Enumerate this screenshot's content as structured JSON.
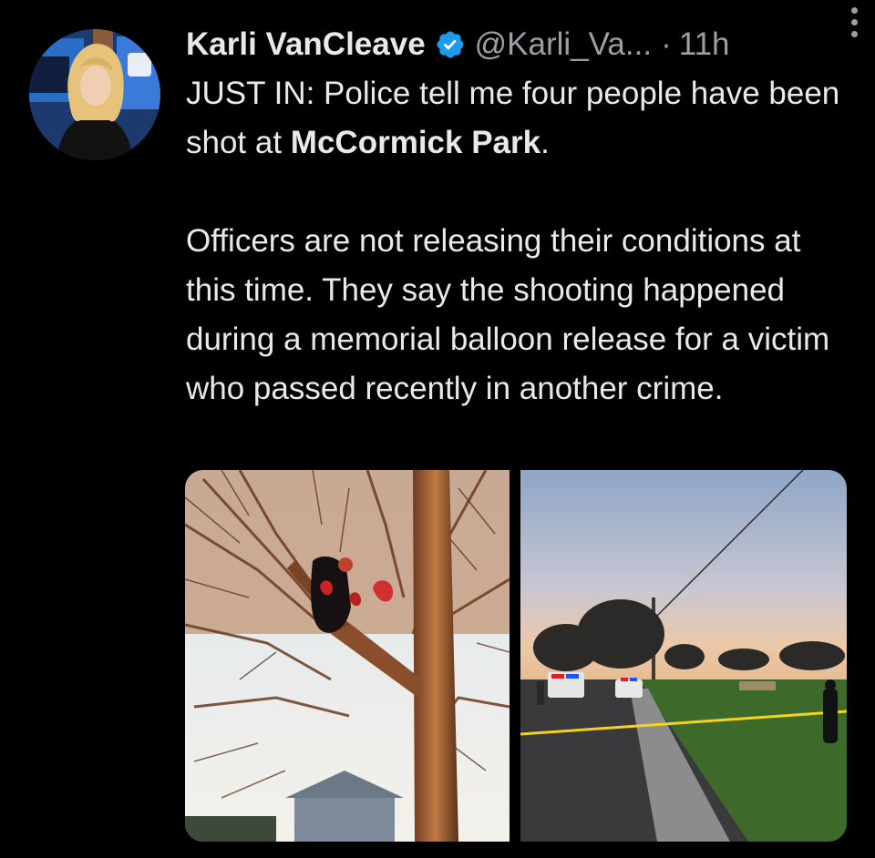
{
  "tweet": {
    "author": {
      "display_name": "Karli VanCleave",
      "handle": "@Karli_Va...",
      "verified_icon": "verified-badge-icon"
    },
    "separator": "·",
    "time": "11h",
    "more_icon": "more-vertical-icon",
    "body": {
      "p1_lead": "JUST IN: Police tell me four people have been shot at ",
      "p1_bold": "McCormick Park",
      "p1_tail": ".",
      "p2": "Officers are not releasing their conditions at this time. They say the shooting happened during a memorial balloon release for a victim who passed recently in another crime."
    }
  },
  "colors": {
    "background": "#000000",
    "text": "#e7e9ea",
    "secondary": "#9aa0a6",
    "verified": "#1d9bf0"
  }
}
